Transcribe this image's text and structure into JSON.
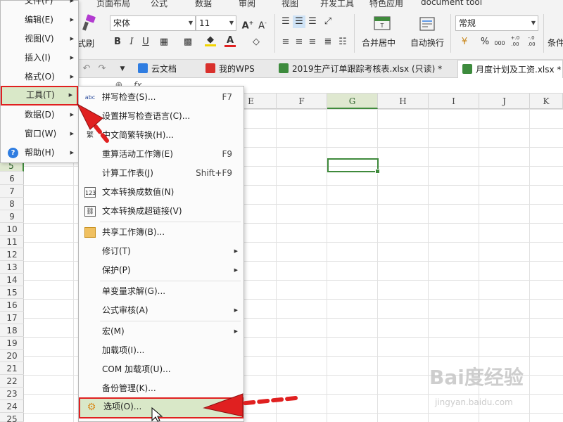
{
  "ribbon": {
    "tabs": [
      "页面布局",
      "公式",
      "数据",
      "审阅",
      "视图",
      "开发工具",
      "特色应用",
      "document tool"
    ],
    "format_painter_label": "式刷",
    "font_name": "宋体",
    "font_size": "11",
    "merge_center_label": "合并居中",
    "wrap_text_label": "自动换行",
    "number_format": "常规",
    "cond_label": "条件",
    "percent": "%",
    "comma": "000",
    "dec_inc": "+.0 .00",
    "dec_dec": "-.0 .00"
  },
  "doc_tabs": [
    {
      "label": "云文档",
      "icon": "cloud-icon",
      "color": "#2f7de1"
    },
    {
      "label": "我的WPS",
      "icon": "wps-icon",
      "color": "#d9302c"
    },
    {
      "label": "2019生产订单跟踪考核表.xlsx (只读) *",
      "icon": "excel-icon",
      "color": "#3d8b3d"
    },
    {
      "label": "月度计划及工资.xlsx *",
      "icon": "excel-icon",
      "color": "#3d8b3d"
    }
  ],
  "formula_bar": {
    "fx": "fx"
  },
  "columns": [
    "E",
    "F",
    "G",
    "H",
    "I",
    "J",
    "K"
  ],
  "rows": [
    "5",
    "6",
    "7",
    "8",
    "9",
    "10",
    "11",
    "12",
    "13",
    "14",
    "15",
    "16",
    "17",
    "18",
    "19",
    "20",
    "21",
    "22",
    "23",
    "24",
    "25"
  ],
  "main_menu": [
    {
      "label": "文件(F)",
      "sub": true
    },
    {
      "label": "编辑(E)",
      "sub": true
    },
    {
      "label": "视图(V)",
      "sub": true
    },
    {
      "label": "插入(I)",
      "sub": true
    },
    {
      "label": "格式(O)",
      "sub": true
    },
    {
      "label": "工具(T)",
      "sub": true
    },
    {
      "label": "数据(D)",
      "sub": true
    },
    {
      "label": "窗口(W)",
      "sub": true
    },
    {
      "label": "帮助(H)",
      "sub": true
    }
  ],
  "tools_menu": [
    {
      "label": "拼写检查(S)...",
      "shortcut": "F7",
      "icon": "spellcheck-icon"
    },
    {
      "label": "设置拼写检查语言(C)...",
      "shortcut": "",
      "icon": "language-icon"
    },
    {
      "label": "中文简繁转换(H)...",
      "shortcut": "",
      "icon": "convert-icon"
    },
    {
      "label": "重算活动工作簿(E)",
      "shortcut": "F9"
    },
    {
      "label": "计算工作表(J)",
      "shortcut": "Shift+F9"
    },
    {
      "label": "文本转换成数值(N)",
      "shortcut": "",
      "icon": "text-to-number-icon"
    },
    {
      "label": "文本转换成超链接(V)",
      "shortcut": "",
      "icon": "text-to-link-icon"
    },
    {
      "label": "共享工作簿(B)...",
      "shortcut": "",
      "icon": "share-icon"
    },
    {
      "label": "修订(T)",
      "sub": true
    },
    {
      "label": "保护(P)",
      "sub": true
    },
    {
      "label": "单变量求解(G)...",
      "shortcut": ""
    },
    {
      "label": "公式审核(A)",
      "sub": true
    },
    {
      "label": "宏(M)",
      "sub": true
    },
    {
      "label": "加载项(I)...",
      "shortcut": ""
    },
    {
      "label": "COM 加载项(U)...",
      "shortcut": ""
    },
    {
      "label": "备份管理(K)...",
      "shortcut": ""
    },
    {
      "label": "选项(O)...",
      "shortcut": "",
      "icon": "gear-icon"
    }
  ],
  "watermark": {
    "text": "Bai度经验",
    "sub": "jingyan.baidu.com"
  },
  "colors": {
    "highlight": "#d9e8c8",
    "annotation_red": "#e02020",
    "selection_green": "#3f8a3c"
  }
}
